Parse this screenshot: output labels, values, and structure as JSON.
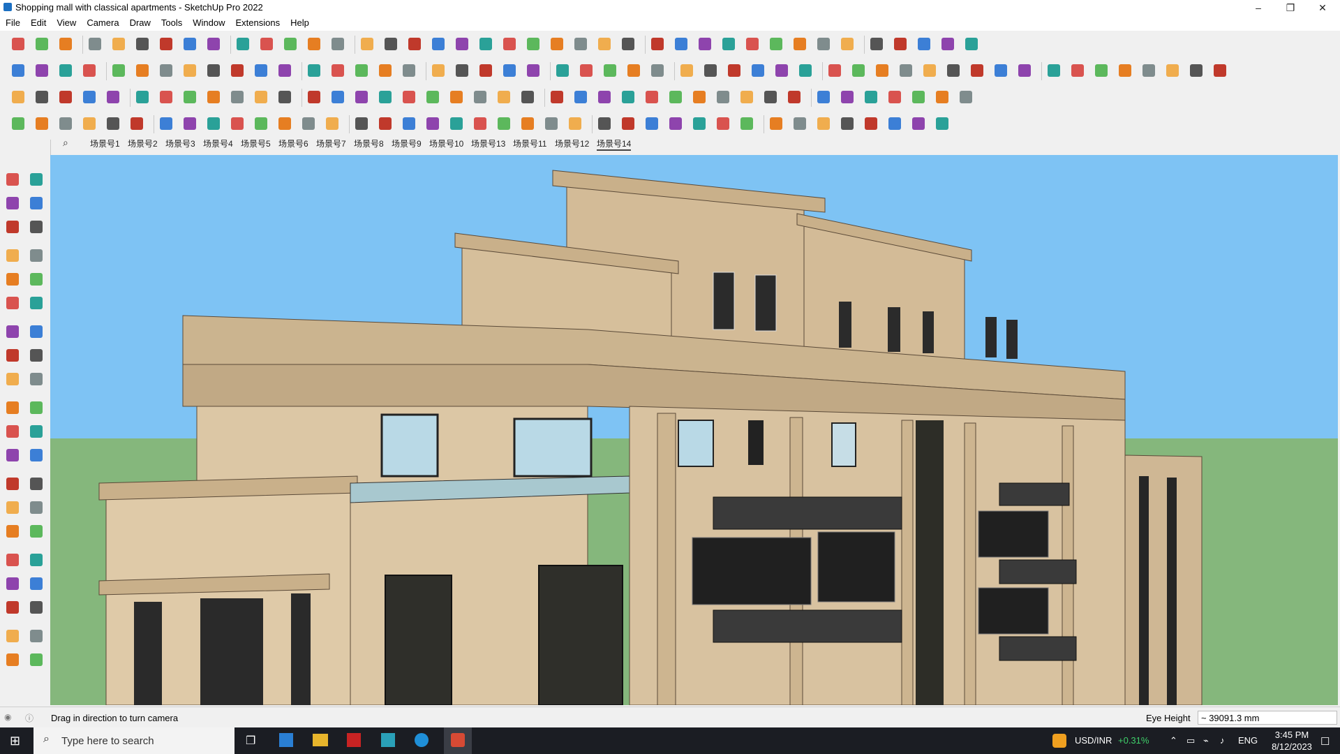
{
  "window": {
    "title": "Shopping mall with classical apartments - SketchUp Pro 2022",
    "controls": [
      "–",
      "❐",
      "✕"
    ]
  },
  "menu": [
    "File",
    "Edit",
    "View",
    "Camera",
    "Draw",
    "Tools",
    "Window",
    "Extensions",
    "Help"
  ],
  "scenes": {
    "tabs": [
      "场景号1",
      "场景号2",
      "场景号3",
      "场景号4",
      "场景号5",
      "场景号6",
      "场景号7",
      "场景号8",
      "场景号9",
      "场景号10",
      "场景号13",
      "场景号11",
      "场景号12",
      "场景号14"
    ],
    "active": "场景号14"
  },
  "status": {
    "hint": "Drag in direction to turn camera",
    "measure_label": "Eye Height",
    "measure_value": "~ 39091.3 mm"
  },
  "taskbar": {
    "search_placeholder": "Type here to search",
    "ticker_label": "USD/INR",
    "ticker_change": "+0.31%",
    "language": "ENG",
    "time": "3:45 PM",
    "date": "8/12/2023"
  },
  "colors": {
    "sky": "#7ec3f4",
    "ground": "#85b77c",
    "stone": "#d8c2a0",
    "ticker_up": "#3fd06a"
  }
}
